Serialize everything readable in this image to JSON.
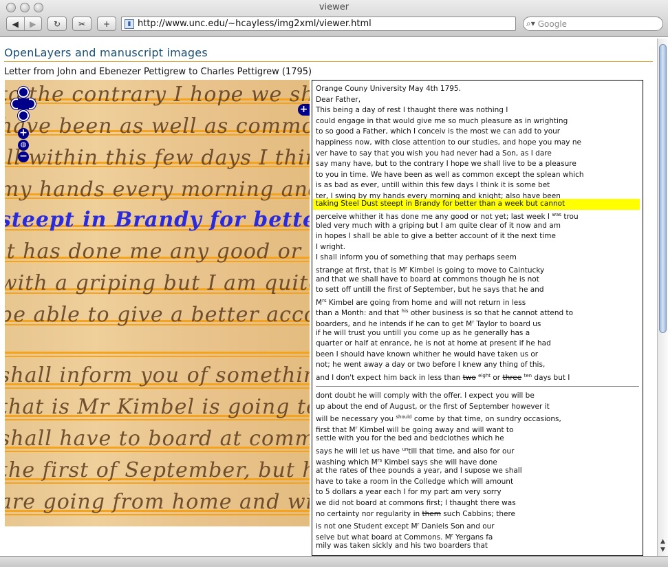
{
  "window": {
    "title": "viewer"
  },
  "toolbar": {
    "back_icon": "◀",
    "forward_icon": "▶",
    "reload_icon": "↻",
    "snapback_icon": "✂",
    "add_bookmark_icon": "+",
    "url": "http://www.unc.edu/~hcayless/img2xml/viewer.html",
    "search_placeholder": "Google"
  },
  "page": {
    "title": "OpenLayers and manuscript images",
    "subtitle": "Letter from John and Ebenezer Pettigrew to Charles Pettigrew (1795)"
  },
  "map": {
    "zoom_in": "+",
    "zoom_out": "−",
    "world": "◍",
    "layer_switcher": "+",
    "highlight_color": "#2a2adf",
    "line_color": "#f5a21c"
  },
  "transcription": {
    "highlight_color": "#ffff00",
    "page1": [
      "Orange Couny University May 4th 1795.",
      "Dear Father,",
      "This being a day of rest I thaught there was nothing I",
      "could engage in that would give me so much pleasure as in wrighting",
      "to so good a Father, which I conceiv is the most we can add to your",
      "happiness now, with close attention to our studies, and hope you may ne",
      "ver have to say that you wish you had never had a Son, as I dare",
      "say many have, but to the contrary I hope we shall live to be a pleasure",
      "to you in time. We have been as well as common except the splean which",
      "is as bad as ever, untill within this few days I think it is some bet",
      "ter, I swing by my hands every morning and knight; also have been",
      "taking Steel Dust steept in Brandy for better than a week but cannot",
      "perceive whither it has done me any good or not yet; last week I",
      "bled very much with a griping but I am quite clear of it now and am",
      "in hopes I shall be able to give a better account of it the next time",
      "I wright.",
      "I shall inform you of something that may perhaps seem",
      "strange at first, that is M",
      "and that we shall have to board at commons though he is not",
      "to sett off untill the first of September, but he says that he and",
      "M",
      "than a Month: and that",
      "boarders, and he intends if he can to get M",
      "if he will trust you untill you come up as he generally has a",
      "quarter or half at enrance, he is not at home at present if he had",
      "been I should have known whither he would have taken us or",
      "not; he went away a day or two before I knew any thing of this,",
      "and I don't expect him back in less than"
    ],
    "sup_was": "was",
    "trou": " trou",
    "kimbel_r": "r",
    "kimbel_rest": " Kimbel is going to move to Caintucky",
    "mrs_rs": "rs",
    "mrs_rest": " Kimbel are going from home and will not return in less",
    "his_sup": "his",
    "his_rest": " other business is so that he cannot attend to",
    "taylor_r": "r",
    "taylor_rest": " Taylor to board us",
    "two": "two",
    "eight": "eight",
    "or": " or ",
    "three": "three",
    "ten": "ten",
    "days_but": " days but I",
    "page2": [
      "dont doubt he will comply with the offer. I expect you will be",
      "up about the end of August, or the first of September however it",
      "will be necessary you",
      "first that M",
      "settle with you for the bed and bedclothes which he",
      "says he will let us have",
      "washing which M",
      "at the rates of thee pounds a year, and I supose we shall",
      "have to take a room in the Colledge which will amount",
      "to 5 dollars a year each I for my part am very sorry",
      "we did not board at commons first; I thaught there was",
      "no certainty nor regularity in",
      "is not one Student except M",
      "selve but what board at Commons. M",
      "mily was taken sickly and his two boarders that"
    ],
    "should_sup": "should",
    "should_rest": " come by that time, on sundry occasions,",
    "kimbel2_r": "r",
    "kimbel2_rest": " Kimbel will be going away and will want to",
    "un_sup": "un",
    "un_rest": "till that time, and also for our",
    "mrs2_rs": "rs",
    "mrs2_rest": " Kimbel says she will have done",
    "them": "them",
    "cabbins": " such Cabbins; there",
    "daniels_r": "r",
    "daniels_rest": " Daniels Son and our",
    "yergans_r": "r",
    "yergans_rest": " Yergans fa"
  },
  "manuscript": [
    "to the contrary I hope we shall",
    "have been as well as common exc",
    "ill within this few days I thin",
    "my hands every morning and knigh",
    "steept in Brandy for better than",
    "it has done me any good or not y",
    "with a griping but I am quite clear",
    "be able to give a better account of",
    "shall inform you of something that m",
    "that is Mr Kimbel is going to mo",
    "shall have to board at commons th",
    "the first of September, but he sa",
    "are going from home and will no"
  ]
}
